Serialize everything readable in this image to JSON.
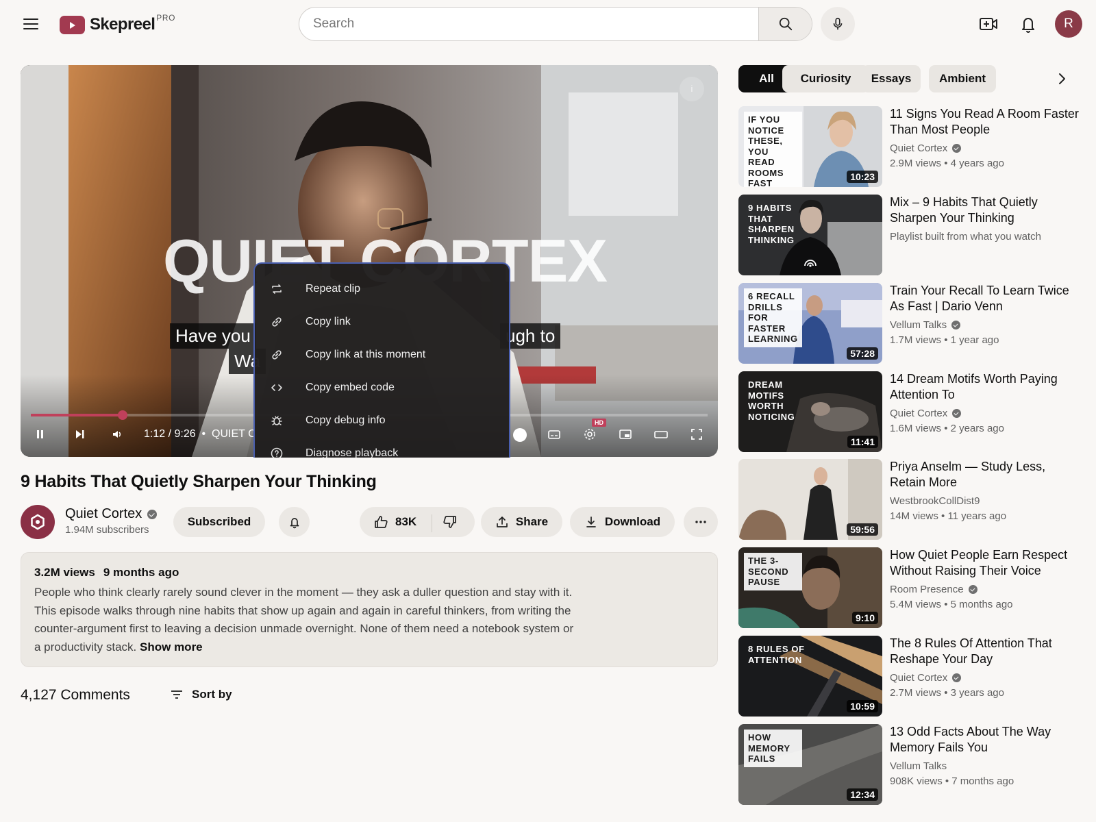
{
  "header": {
    "logo_text": "Skepreel",
    "logo_sup": "PRO",
    "search_placeholder": "Search",
    "avatar_initial": "R"
  },
  "player": {
    "watermark": "QUIET CORTEX",
    "caption_line1_left": "Have you",
    "caption_line1_right": "ugh to",
    "caption_line2": "Wa",
    "time": "1:12 / 9:26",
    "chapter": "QUIET C",
    "info_label": "i",
    "hd_label": "HD",
    "progress_fraction": 0.136
  },
  "context_menu": {
    "items": [
      {
        "label": "Repeat clip",
        "icon": "repeat-icon"
      },
      {
        "label": "Copy link",
        "icon": "link-icon"
      },
      {
        "label": "Copy link at this moment",
        "icon": "link-icon"
      },
      {
        "label": "Copy embed code",
        "icon": "code-icon"
      },
      {
        "label": "Copy debug info",
        "icon": "bug-icon"
      },
      {
        "label": "Diagnose playback",
        "icon": "help-icon"
      }
    ]
  },
  "video": {
    "title": "9 Habits That Quietly Sharpen Your Thinking",
    "channel": "Quiet Cortex",
    "subscribers": "1.94M subscribers",
    "subscribed_label": "Subscribed",
    "likes": "83K",
    "share_label": "Share",
    "download_label": "Download",
    "views": "3.2M views",
    "posted": "9 months ago",
    "description": "People who think clearly rarely sound clever in the moment — they ask a duller question and stay with it. This episode walks through nine habits that show up again and again in careful thinkers, from writing the counter-argument first to leaving a decision unmade overnight. None of them need a notebook system or a productivity stack.",
    "show_more": "Show more",
    "comments_count": "4,127 Comments",
    "sort_label": "Sort by"
  },
  "chips": [
    "All",
    "Curiosity",
    "Essays",
    "Ambient"
  ],
  "recommendations": [
    {
      "thumb_label": "IF YOU NOTICE THESE, YOU READ ROOMS FAST",
      "duration": "10:23",
      "title": "11 Signs You Read A Room Faster Than Most People",
      "channel": "Quiet Cortex",
      "verified": true,
      "stats": "2.9M views • 4 years ago"
    },
    {
      "thumb_label": "9 HABITS THAT SHARPEN THINKING",
      "duration": "",
      "title": "Mix – 9 Habits That Quietly Sharpen Your Thinking",
      "channel": "",
      "verified": false,
      "stats": "Playlist built from what you watch"
    },
    {
      "thumb_label": "6 RECALL DRILLS FOR FASTER LEARNING",
      "duration": "57:28",
      "title": "Train Your Recall To Learn Twice As Fast | Dario Venn",
      "channel": "Vellum Talks",
      "verified": true,
      "stats": "1.7M views • 1 year ago"
    },
    {
      "thumb_label": "DREAM MOTIFS WORTH NOTICING",
      "duration": "11:41",
      "title": "14 Dream Motifs Worth Paying Attention To",
      "channel": "Quiet Cortex",
      "verified": true,
      "stats": "1.6M views • 2 years ago"
    },
    {
      "thumb_label": "",
      "duration": "59:56",
      "title": "Priya Anselm — Study Less, Retain More",
      "channel": "WestbrookCollDist9",
      "verified": false,
      "stats": "14M views • 11 years ago"
    },
    {
      "thumb_label": "THE 3-SECOND PAUSE",
      "duration": "9:10",
      "title": "How Quiet People Earn Respect Without Raising Their Voice",
      "channel": "Room Presence",
      "verified": true,
      "stats": "5.4M views • 5 months ago"
    },
    {
      "thumb_label": "8 RULES OF ATTENTION",
      "duration": "10:59",
      "title": "The 8 Rules Of Attention That Reshape Your Day",
      "channel": "Quiet Cortex",
      "verified": true,
      "stats": "2.7M views • 3 years ago"
    },
    {
      "thumb_label": "HOW MEMORY FAILS",
      "duration": "12:34",
      "title": "13 Odd Facts About The Way Memory Fails You",
      "channel": "Vellum Talks",
      "verified": false,
      "stats": "908K views • 7 months ago"
    }
  ]
}
